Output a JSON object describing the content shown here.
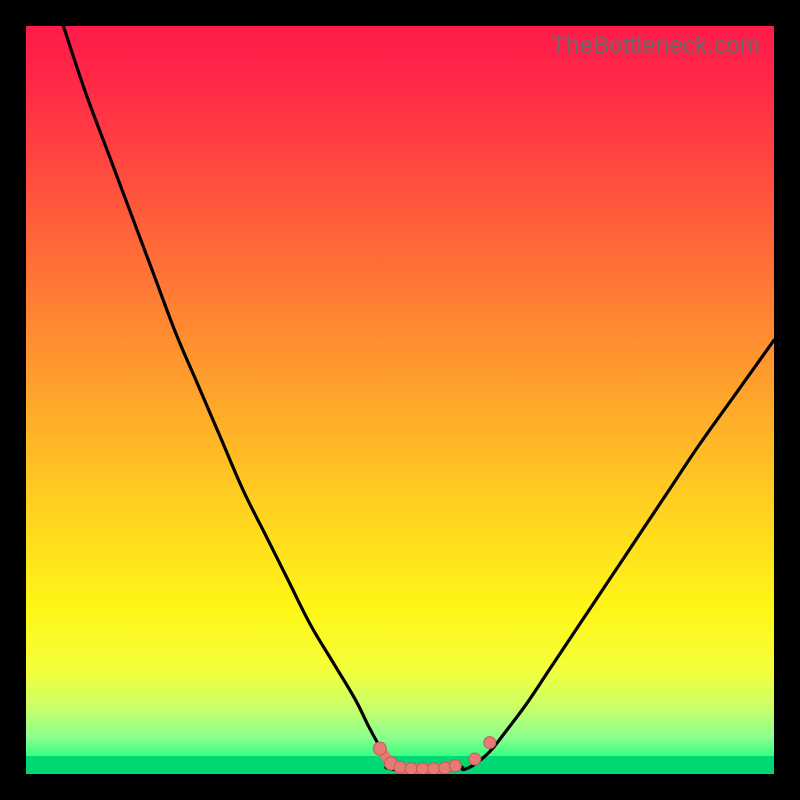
{
  "watermark": "TheBottleneck.com",
  "colors": {
    "frame": "#000000",
    "curve": "#000000",
    "marker_fill": "#e77a76",
    "marker_stroke": "#c95854",
    "gradient_top": "#ff1a4a",
    "gradient_bottom": "#00e77a"
  },
  "chart_data": {
    "type": "line",
    "title": "",
    "xlabel": "",
    "ylabel": "",
    "xlim": [
      0,
      100
    ],
    "ylim": [
      0,
      100
    ],
    "grid": false,
    "legend": false,
    "series": [
      {
        "name": "left-branch",
        "x": [
          5,
          8,
          11,
          14,
          17,
          20,
          23,
          26,
          29,
          32,
          35,
          38,
          41,
          44,
          46,
          47.8,
          50.0,
          52.0
        ],
        "values": [
          100,
          91,
          83,
          75,
          67,
          59,
          52,
          45,
          38,
          32,
          26,
          20,
          15,
          10,
          6,
          3.0,
          1.2,
          0.6
        ]
      },
      {
        "name": "right-branch",
        "x": [
          58.5,
          60,
          62,
          64,
          67,
          70,
          74,
          78,
          82,
          86,
          90,
          95,
          100
        ],
        "values": [
          0.6,
          1.3,
          3.0,
          5.5,
          9.5,
          14,
          20,
          26,
          32,
          38,
          44,
          51,
          58
        ]
      },
      {
        "name": "valley-floor",
        "x": [
          48.2,
          49.5,
          51,
          52.5,
          54,
          55.5,
          57,
          58.3
        ],
        "values": [
          0.9,
          0.55,
          0.5,
          0.5,
          0.5,
          0.55,
          0.7,
          0.9
        ]
      }
    ],
    "markers": {
      "left_cluster": {
        "x": [
          47.3,
          48.8
        ],
        "values": [
          3.4,
          1.4
        ],
        "link_width": 10
      },
      "floor_cluster": {
        "x": [
          50.0,
          51.5,
          53.0,
          54.5,
          56.0,
          57.4
        ],
        "values": [
          0.9,
          0.7,
          0.7,
          0.7,
          0.8,
          1.1
        ],
        "link_width": 10
      },
      "right_dots": {
        "x": [
          60.0,
          62.0
        ],
        "values": [
          2.0,
          4.2
        ]
      }
    }
  }
}
